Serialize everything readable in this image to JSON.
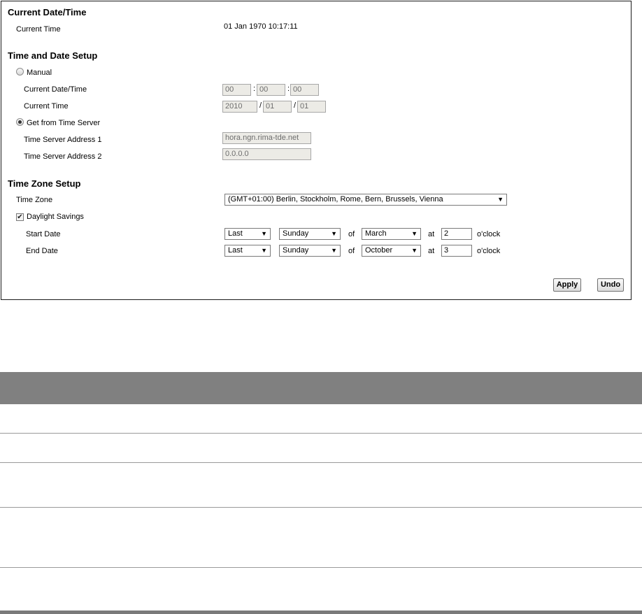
{
  "current_section": {
    "heading": "Current Date/Time",
    "current_time_label": "Current Time",
    "current_time_value": "01 Jan 1970 10:17:11"
  },
  "setup_section": {
    "heading": "Time and Date Setup",
    "manual_label": "Manual",
    "manual_selected": false,
    "date_time_label": "Current Date/Time",
    "time_fields": [
      "00",
      "00",
      "00"
    ],
    "time_sep": ":",
    "current_time_label": "Current Time",
    "date_fields": [
      "2010",
      "01",
      "01"
    ],
    "date_sep": "/",
    "server_label": "Get from Time Server",
    "server_selected": true,
    "server1_label": "Time Server Address 1",
    "server1_value": "hora.ngn.rima-tde.net",
    "server2_label": "Time Server Address 2",
    "server2_value": "0.0.0.0"
  },
  "zone_section": {
    "heading": "Time Zone Setup",
    "timezone_label": "Time Zone",
    "timezone_value": "(GMT+01:00) Berlin, Stockholm, Rome, Bern, Brussels, Vienna",
    "dst_label": "Daylight Savings",
    "dst_checked": true,
    "dst_check_glyph": "✔",
    "of_label": "of",
    "at_label": "at",
    "oclock_label": "o'clock",
    "start": {
      "label": "Start Date",
      "week": "Last",
      "day": "Sunday",
      "month": "March",
      "hour": "2"
    },
    "end": {
      "label": "End Date",
      "week": "Last",
      "day": "Sunday",
      "month": "October",
      "hour": "3"
    },
    "dropdown_arrow": "▼"
  },
  "actions": {
    "apply_label": "Apply",
    "undo_label": "Undo"
  },
  "colors": {
    "table_header": "#808080",
    "field_bg": "#ecebe6"
  }
}
